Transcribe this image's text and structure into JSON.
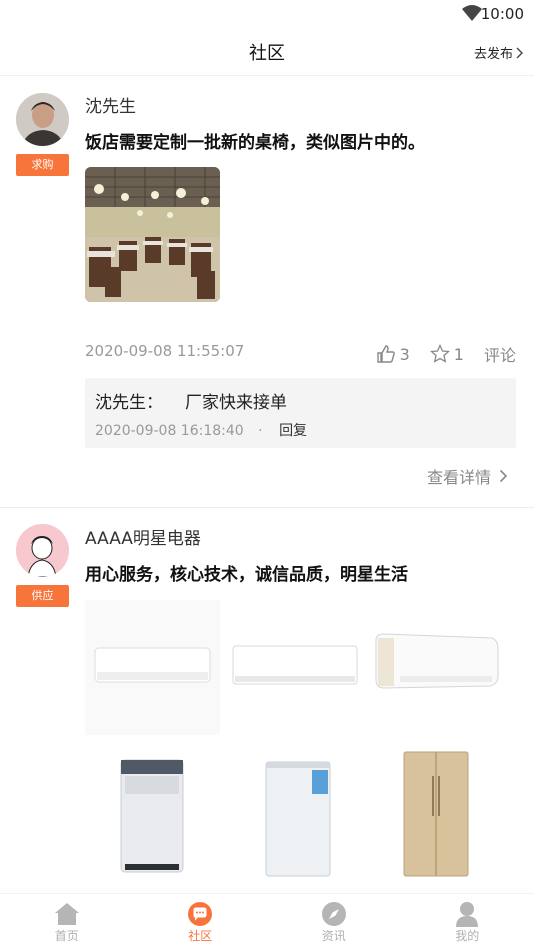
{
  "status_bar": {
    "time": "10:00"
  },
  "header": {
    "title": "社区",
    "publish_label": "去发布"
  },
  "posts": [
    {
      "username": "沈先生",
      "tag": "求购",
      "content": "饭店需要定制一批新的桌椅，类似图片中的。",
      "time": "2020-09-08 11:55:07",
      "likes": "3",
      "stars": "1",
      "comment_label": "评论",
      "comments": [
        {
          "author": "沈先生：",
          "text": "厂家快来接单",
          "time": "2020-09-08 16:18:40",
          "dot": "·",
          "reply_label": "回复"
        }
      ],
      "detail_label": "查看详情"
    },
    {
      "username": "AAAA明星电器",
      "tag": "供应",
      "content": "用心服务，核心技术，诚信品质，明星生活",
      "images": [
        "air-conditioner",
        "air-conditioner",
        "air-conditioner",
        "washing-machine",
        "freezer",
        "refrigerator"
      ]
    }
  ],
  "tabbar": [
    {
      "label": "首页",
      "icon": "home-icon"
    },
    {
      "label": "社区",
      "icon": "community-icon",
      "active": true
    },
    {
      "label": "资讯",
      "icon": "compass-icon"
    },
    {
      "label": "我的",
      "icon": "user-icon"
    }
  ],
  "colors": {
    "accent": "#f7743b",
    "muted": "#999999",
    "comment_bg": "#f4f4f4"
  }
}
